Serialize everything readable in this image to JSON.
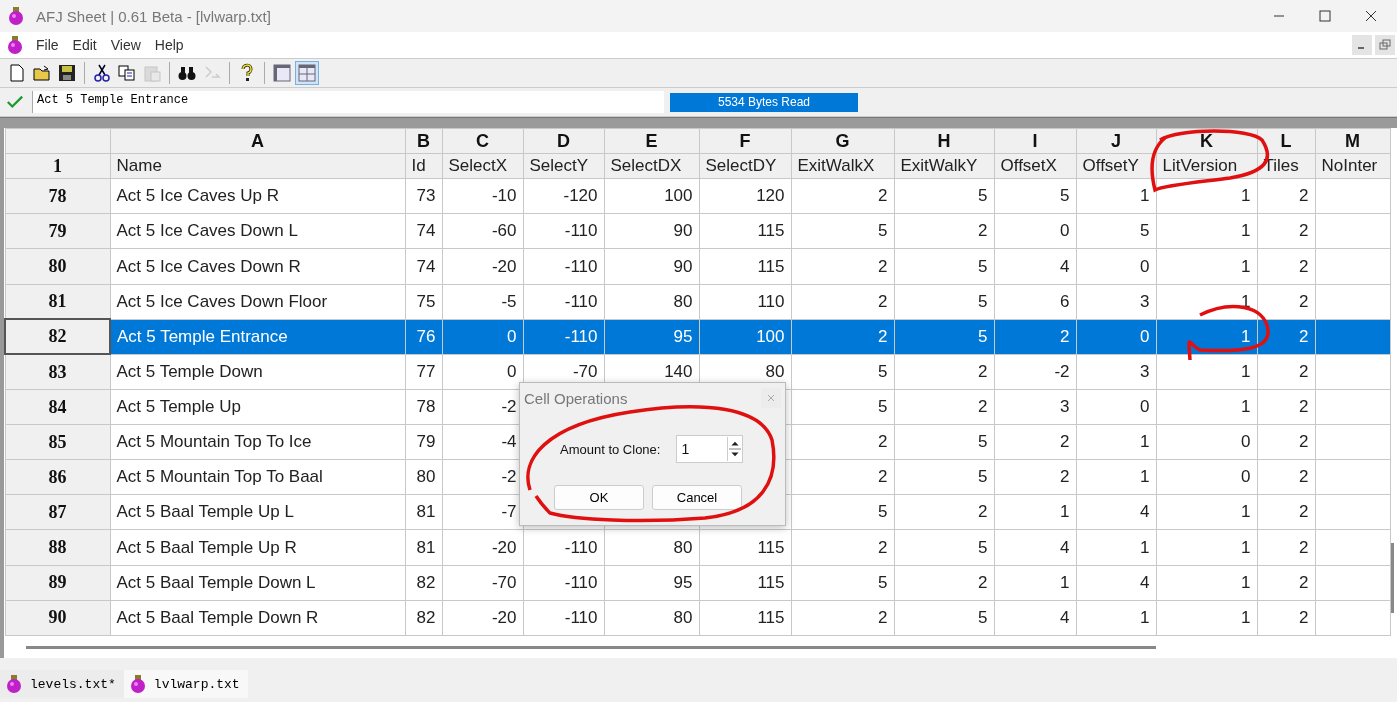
{
  "window": {
    "title": "AFJ Sheet | 0.61 Beta - [lvlwarp.txt]"
  },
  "menu": [
    "File",
    "Edit",
    "View",
    "Help"
  ],
  "toolbar": [
    [
      {
        "kind": "new",
        "disabled": false,
        "on": false
      },
      {
        "kind": "open",
        "disabled": false,
        "on": false
      },
      {
        "kind": "save",
        "disabled": false,
        "on": false
      }
    ],
    [
      {
        "kind": "cut",
        "disabled": false,
        "on": false
      },
      {
        "kind": "copy",
        "disabled": false,
        "on": false
      },
      {
        "kind": "paste",
        "disabled": true,
        "on": false
      }
    ],
    [
      {
        "kind": "find",
        "disabled": false,
        "on": false
      },
      {
        "kind": "replace",
        "disabled": true,
        "on": false
      }
    ],
    [
      {
        "kind": "help",
        "disabled": false,
        "on": false
      }
    ],
    [
      {
        "kind": "layout",
        "disabled": false,
        "on": false
      },
      {
        "kind": "grid",
        "disabled": false,
        "on": true
      }
    ]
  ],
  "formula_bar": {
    "value": "Act 5 Temple Entrance",
    "status": "5534 Bytes Read"
  },
  "grid": {
    "corner": "1",
    "columns": [
      {
        "letter": "A",
        "name": "Name"
      },
      {
        "letter": "B",
        "name": "Id"
      },
      {
        "letter": "C",
        "name": "SelectX"
      },
      {
        "letter": "D",
        "name": "SelectY"
      },
      {
        "letter": "E",
        "name": "SelectDX"
      },
      {
        "letter": "F",
        "name": "SelectDY"
      },
      {
        "letter": "G",
        "name": "ExitWalkX"
      },
      {
        "letter": "H",
        "name": "ExitWalkY"
      },
      {
        "letter": "I",
        "name": "OffsetX"
      },
      {
        "letter": "J",
        "name": "OffsetY"
      },
      {
        "letter": "K",
        "name": "LitVersion"
      },
      {
        "letter": "L",
        "name": "Tiles"
      },
      {
        "letter": "M",
        "name": "NoInter"
      }
    ],
    "rows": [
      {
        "num": "78",
        "selected": false,
        "cells": [
          "Act 5 Ice Caves Up R",
          "73",
          "-10",
          "-120",
          "100",
          "120",
          "2",
          "5",
          "5",
          "1",
          "1",
          "2"
        ]
      },
      {
        "num": "79",
        "selected": false,
        "cells": [
          "Act 5 Ice Caves Down L",
          "74",
          "-60",
          "-110",
          "90",
          "115",
          "5",
          "2",
          "0",
          "5",
          "1",
          "2"
        ]
      },
      {
        "num": "80",
        "selected": false,
        "cells": [
          "Act 5 Ice Caves Down R",
          "74",
          "-20",
          "-110",
          "90",
          "115",
          "2",
          "5",
          "4",
          "0",
          "1",
          "2"
        ]
      },
      {
        "num": "81",
        "selected": false,
        "cells": [
          "Act 5 Ice Caves Down Floor",
          "75",
          "-5",
          "-110",
          "80",
          "110",
          "2",
          "5",
          "6",
          "3",
          "1",
          "2"
        ]
      },
      {
        "num": "82",
        "selected": true,
        "cells": [
          "Act 5 Temple Entrance",
          "76",
          "0",
          "-110",
          "95",
          "100",
          "2",
          "5",
          "2",
          "0",
          "1",
          "2"
        ]
      },
      {
        "num": "83",
        "selected": false,
        "cells": [
          "Act 5 Temple Down",
          "77",
          "0",
          "-70",
          "140",
          "80",
          "5",
          "2",
          "-2",
          "3",
          "1",
          "2"
        ]
      },
      {
        "num": "84",
        "selected": false,
        "cells": [
          "Act 5 Temple Up",
          "78",
          "-2",
          null,
          null,
          null,
          "5",
          "2",
          "3",
          "0",
          "1",
          "2"
        ]
      },
      {
        "num": "85",
        "selected": false,
        "cells": [
          "Act 5 Mountain Top To Ice",
          "79",
          "-4",
          null,
          null,
          null,
          "2",
          "5",
          "2",
          "1",
          "0",
          "2"
        ]
      },
      {
        "num": "86",
        "selected": false,
        "cells": [
          "Act 5 Mountain Top To Baal",
          "80",
          "-2",
          null,
          null,
          null,
          "2",
          "5",
          "2",
          "1",
          "0",
          "2"
        ]
      },
      {
        "num": "87",
        "selected": false,
        "cells": [
          "Act 5 Baal Temple Up L",
          "81",
          "-7",
          null,
          null,
          null,
          "5",
          "2",
          "1",
          "4",
          "1",
          "2"
        ]
      },
      {
        "num": "88",
        "selected": false,
        "cells": [
          "Act 5 Baal Temple Up R",
          "81",
          "-20",
          "-110",
          "80",
          "115",
          "2",
          "5",
          "4",
          "1",
          "1",
          "2"
        ]
      },
      {
        "num": "89",
        "selected": false,
        "cells": [
          "Act 5 Baal Temple Down L",
          "82",
          "-70",
          "-110",
          "95",
          "115",
          "5",
          "2",
          "1",
          "4",
          "1",
          "2"
        ]
      },
      {
        "num": "90",
        "selected": false,
        "cells": [
          "Act 5 Baal Temple Down R",
          "82",
          "-20",
          "-110",
          "80",
          "115",
          "2",
          "5",
          "4",
          "1",
          "1",
          "2"
        ]
      }
    ]
  },
  "dialog": {
    "title": "Cell Operations",
    "label": "Amount to Clone:",
    "value": "1",
    "buttons": [
      "OK",
      "Cancel"
    ]
  },
  "sheet_tabs": [
    {
      "label": "levels.txt*",
      "selected": false
    },
    {
      "label": "lvlwarp.txt",
      "selected": true
    }
  ]
}
